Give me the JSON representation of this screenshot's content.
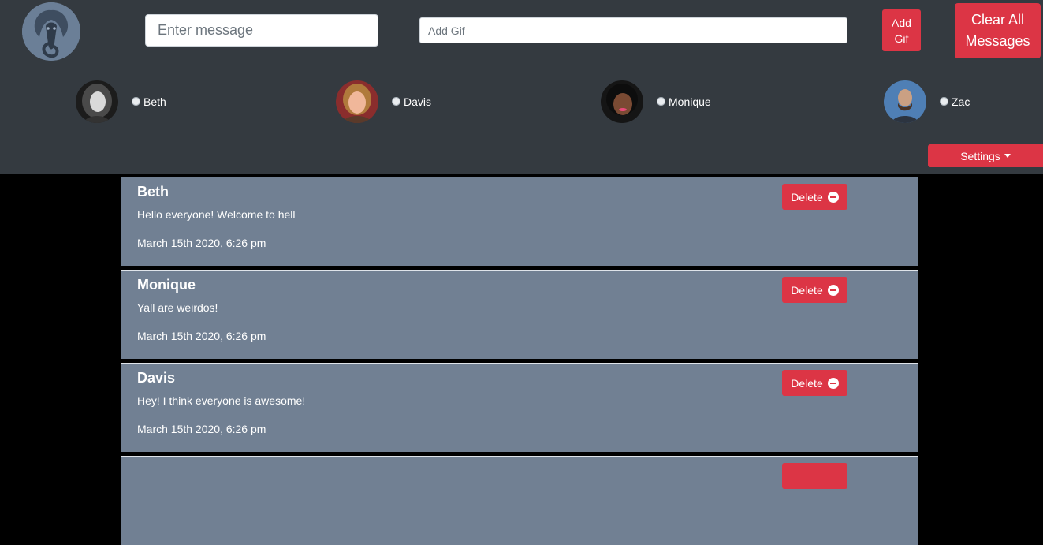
{
  "header": {
    "logo_icon": "cobra-icon",
    "message_input": {
      "placeholder": "Enter message",
      "value": ""
    },
    "gif_input": {
      "placeholder": "Add Gif",
      "value": ""
    },
    "add_gif_label": "Add Gif",
    "clear_all_label": "Clear All Messages",
    "settings_label": "Settings"
  },
  "users": [
    {
      "name": "Beth"
    },
    {
      "name": "Davis"
    },
    {
      "name": "Monique"
    },
    {
      "name": "Zac"
    }
  ],
  "messages": [
    {
      "author": "Beth",
      "text": "Hello everyone! Welcome to hell",
      "time": "March 15th 2020, 6:26 pm",
      "delete_label": "Delete"
    },
    {
      "author": "Monique",
      "text": "Yall are weirdos!",
      "time": "March 15th 2020, 6:26 pm",
      "delete_label": "Delete"
    },
    {
      "author": "Davis",
      "text": "Hey! I think everyone is awesome!",
      "time": "March 15th 2020, 6:26 pm",
      "delete_label": "Delete"
    },
    {
      "author": "",
      "text": "",
      "time": "",
      "delete_label": ""
    }
  ],
  "colors": {
    "header_bg": "#343a40",
    "card_bg": "#718093",
    "danger": "#dc3545",
    "page_bg": "#000000",
    "logo_bg": "#6b7f97"
  }
}
